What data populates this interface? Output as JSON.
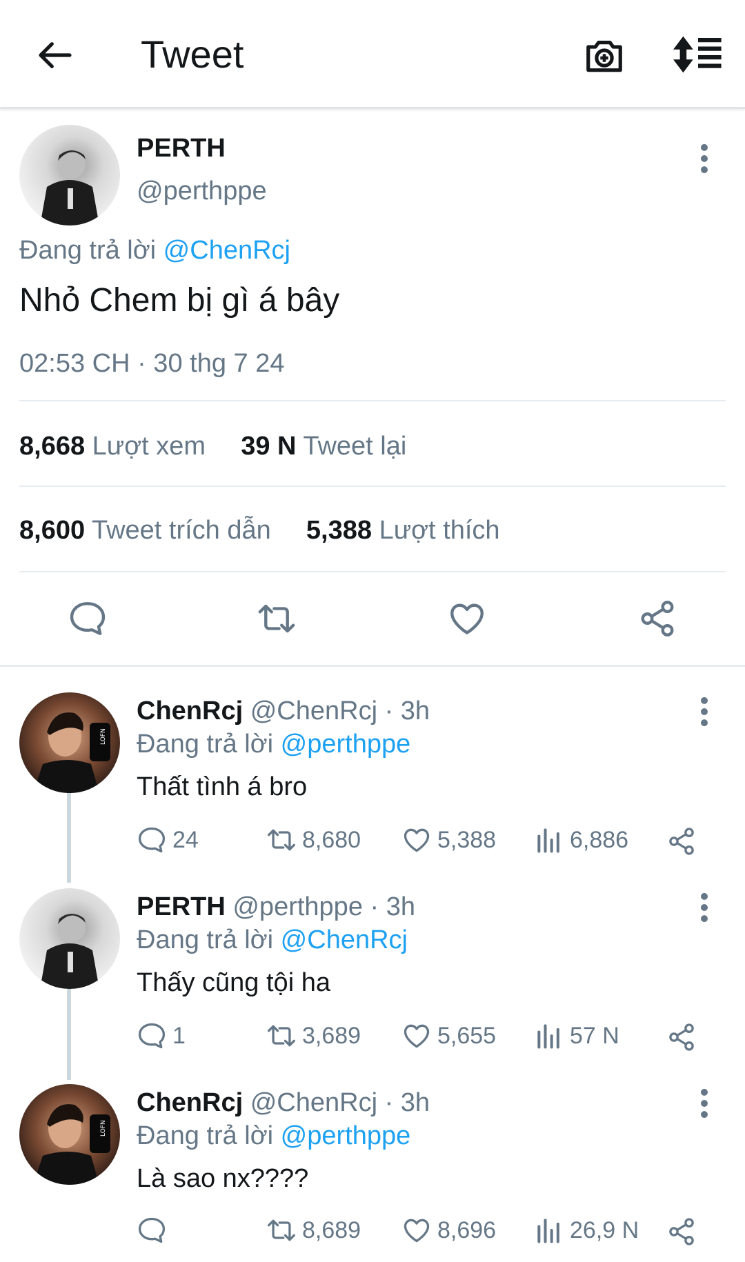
{
  "header": {
    "title": "Tweet"
  },
  "main_tweet": {
    "name": "PERTH",
    "handle": "@perthppe",
    "reply_prefix": "Đang trả lời",
    "reply_to": "@ChenRcj",
    "text": "Nhỏ Chem bị gì á bây",
    "timestamp": "02:53 CH · 30 thg 7 24",
    "stats": {
      "views_num": "8,668",
      "views_label": "Lượt xem",
      "retweets_num": "39 N",
      "retweets_label": "Tweet lại",
      "quotes_num": "8,600",
      "quotes_label": "Tweet trích dẫn",
      "likes_num": "5,388",
      "likes_label": "Lượt thích"
    }
  },
  "replies": [
    {
      "name": "ChenRcj",
      "handle_time": "@ChenRcj · 3h",
      "reply_prefix": "Đang trả lời",
      "reply_to": "@perthppe",
      "text": "Thất tình á bro",
      "replies": "24",
      "retweets": "8,680",
      "likes": "5,388",
      "views": "6,886"
    },
    {
      "name": "PERTH",
      "handle_time": "@perthppe · 3h",
      "reply_prefix": "Đang trả lời",
      "reply_to": "@ChenRcj",
      "text": "Thấy cũng tội ha",
      "replies": "1",
      "retweets": "3,689",
      "likes": "5,655",
      "views": "57 N"
    },
    {
      "name": "ChenRcj",
      "handle_time": "@ChenRcj · 3h",
      "reply_prefix": "Đang trả lời",
      "reply_to": "@perthppe",
      "text": "Là sao nx????",
      "replies": "",
      "retweets": "8,689",
      "likes": "8,696",
      "views": "26,9 N"
    }
  ],
  "colors": {
    "accent": "#1da1f2",
    "secondary_text": "#657786",
    "icon": "#657786"
  }
}
